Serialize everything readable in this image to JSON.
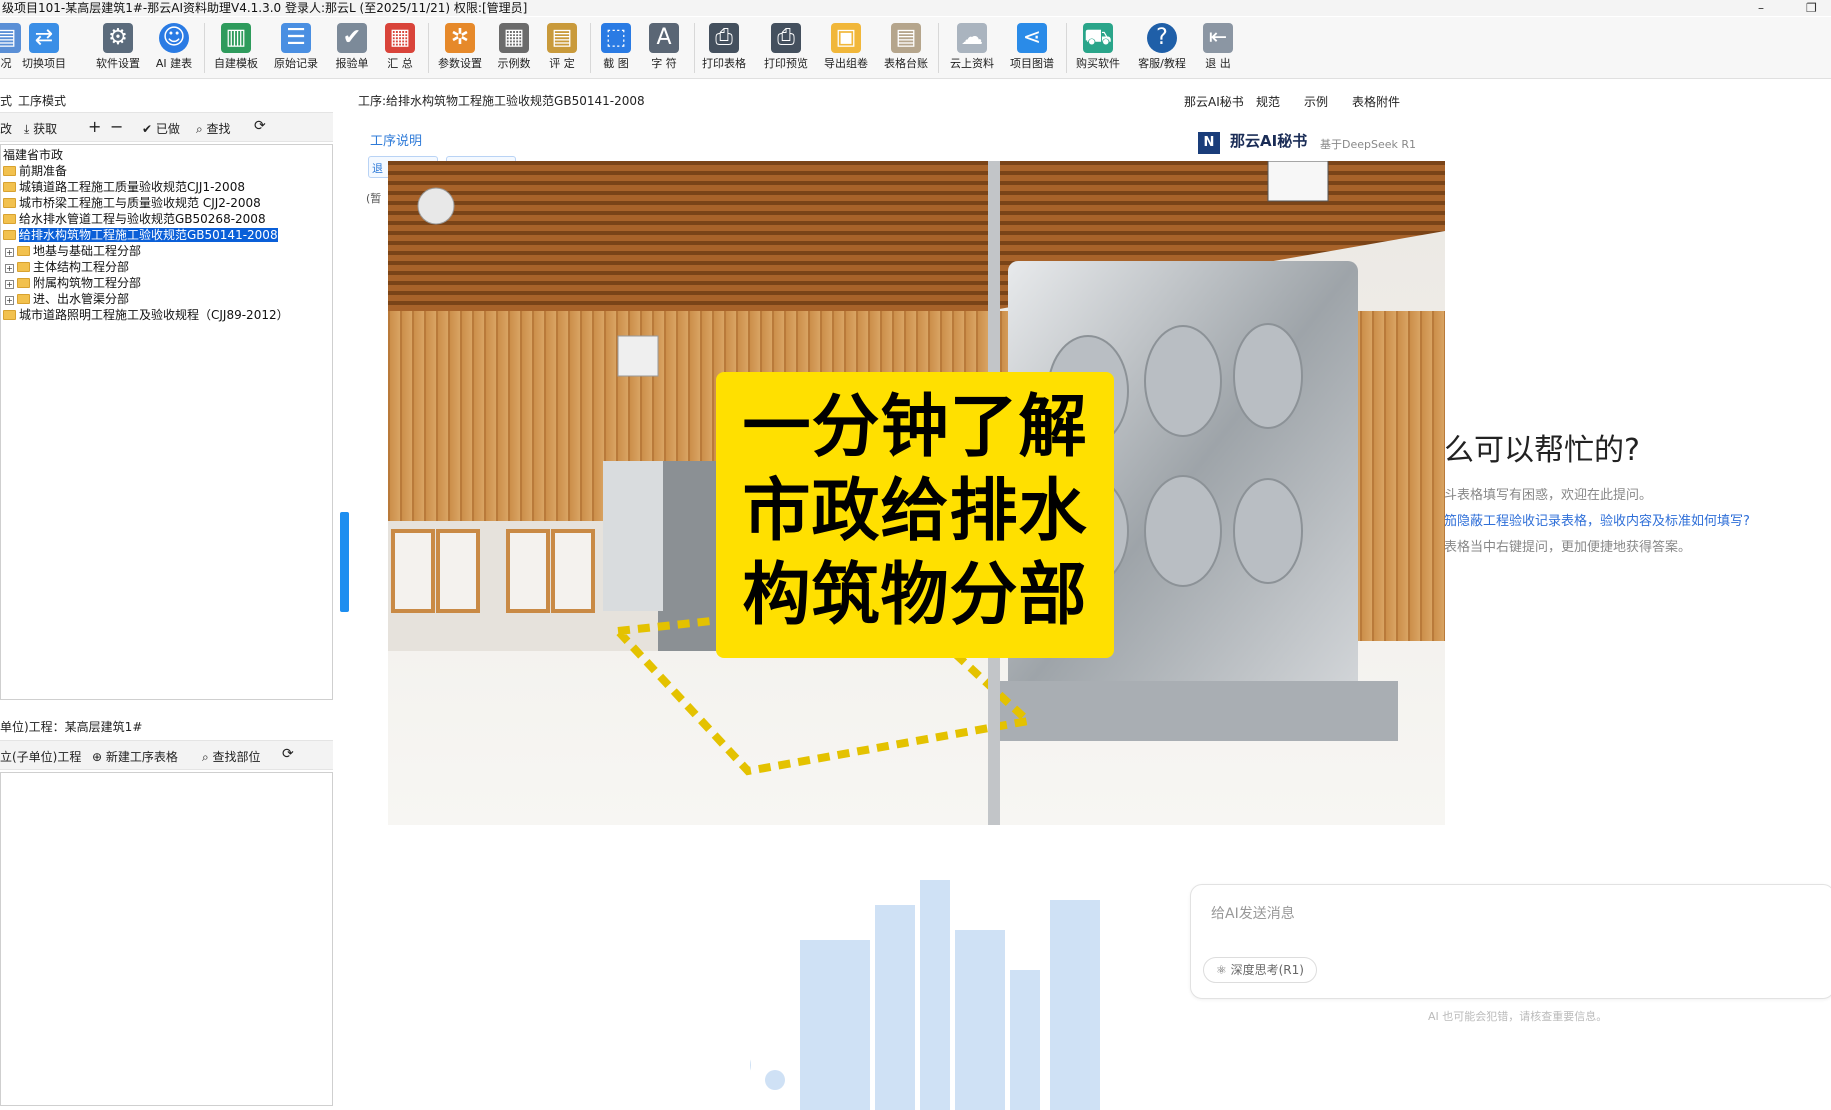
{
  "window": {
    "title": "级项目101-某高层建筑1#-那云AI资料助理V4.1.3.0 登录人:那云L (至2025/11/21) 权限:[管理员]",
    "minimize": "–",
    "restore": "❐"
  },
  "toolbar": {
    "items": [
      {
        "label": "况",
        "icon": "partial-icon"
      },
      {
        "label": "切换项目",
        "icon": "switch-arrows-icon"
      },
      {
        "label": "软件设置",
        "icon": "gear-icon"
      },
      {
        "label": "AI 建表",
        "icon": "ai-icon"
      },
      {
        "label": "自建模板",
        "icon": "template-book-icon"
      },
      {
        "label": "原始记录",
        "icon": "list-icon"
      },
      {
        "label": "报验单",
        "icon": "checklist-icon"
      },
      {
        "label": "汇 总",
        "icon": "summary-icon"
      },
      {
        "label": "参数设置",
        "icon": "gears-icon"
      },
      {
        "label": "示例数",
        "icon": "calculator-icon"
      },
      {
        "label": "评 定",
        "icon": "clipboard-icon"
      },
      {
        "label": "截 图",
        "icon": "screenshot-icon"
      },
      {
        "label": "字 符",
        "icon": "character-icon"
      },
      {
        "label": "打印表格",
        "icon": "printer-icon"
      },
      {
        "label": "打印预览",
        "icon": "print-preview-icon"
      },
      {
        "label": "导出组卷",
        "icon": "export-box-icon"
      },
      {
        "label": "表格台账",
        "icon": "ledger-icon"
      },
      {
        "label": "云上资料",
        "icon": "cloud-icon"
      },
      {
        "label": "项目图谱",
        "icon": "share-graph-icon"
      },
      {
        "label": "购买软件",
        "icon": "cart-icon"
      },
      {
        "label": "客服/教程",
        "icon": "help-icon"
      },
      {
        "label": "退 出",
        "icon": "exit-icon"
      }
    ]
  },
  "left": {
    "tabs": [
      "式",
      "工序模式"
    ],
    "actions": [
      "改",
      "获取",
      "+",
      "−",
      "已做",
      "查找",
      "⟳"
    ],
    "tree": [
      {
        "label": "福建省市政",
        "level": 0,
        "folder": false,
        "expander": ""
      },
      {
        "label": "前期准备",
        "level": 0,
        "folder": true,
        "expander": ""
      },
      {
        "label": "城镇道路工程施工质量验收规范CJJ1-2008",
        "level": 0,
        "folder": true,
        "expander": ""
      },
      {
        "label": "城市桥梁工程施工与质量验收规范 CJJ2-2008",
        "level": 0,
        "folder": true,
        "expander": ""
      },
      {
        "label": "给水排水管道工程与验收规范GB50268-2008",
        "level": 0,
        "folder": true,
        "expander": ""
      },
      {
        "label": "给排水构筑物工程施工验收规范GB50141-2008",
        "level": 0,
        "folder": true,
        "selected": true,
        "expander": ""
      },
      {
        "label": "地基与基础工程分部",
        "level": 1,
        "folder": true,
        "expander": "+"
      },
      {
        "label": "主体结构工程分部",
        "level": 1,
        "folder": true,
        "expander": "+"
      },
      {
        "label": "附属构筑物工程分部",
        "level": 1,
        "folder": true,
        "expander": "+"
      },
      {
        "label": "进、出水管渠分部",
        "level": 1,
        "folder": true,
        "expander": "+"
      },
      {
        "label": "城市道路照明工程施工及验收规程（CJJ89-2012）",
        "level": 0,
        "folder": true,
        "expander": ""
      }
    ],
    "unit_label": "单位)工程：某高层建筑1#",
    "unit_actions": [
      "立(子单位)工程",
      "新建工序表格",
      "查找部位",
      "⟳"
    ]
  },
  "center": {
    "process_title": "工序:给排水构筑物工程施工验收规范GB50141-2008",
    "hint": "工序说明",
    "mini_a": "退",
    "mini_b": "(暂"
  },
  "overlay": {
    "caption_lines": [
      "一分钟了解",
      "市政给排水",
      "构筑物分部"
    ],
    "caption_bg": "#ffe000"
  },
  "right": {
    "tabs": [
      "那云AI秘书",
      "规范",
      "示例",
      "表格附件"
    ],
    "ai_title": "那云AI秘书",
    "ai_subtitle": "基于DeepSeek R1",
    "ai_question": "么可以帮忙的?",
    "ai_lines": [
      {
        "text": "斗表格填写有困惑，欢迎在此提问。",
        "color": "#888888"
      },
      {
        "text": "笳隐蔽工程验收记录表格，验收内容及标准如何填写?",
        "color": "#2f6fd8"
      },
      {
        "text": "表格当中右键提问，更加便捷地获得答案。",
        "color": "#888888"
      }
    ],
    "input_placeholder": "给AI发送消息",
    "deep_think": "深度思考(R1)",
    "disclaimer": "AI 也可能会犯错，请核查重要信息。"
  }
}
